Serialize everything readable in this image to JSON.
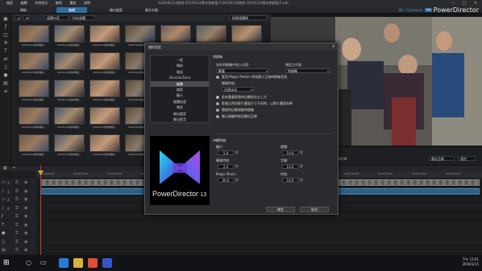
{
  "titlebar": {
    "menu": [
      "檔案",
      "編輯",
      "外掛程式",
      "檢視",
      "播放",
      "說明"
    ],
    "path": "X\\20160114移除-20150124素本物館電子\\20160114移除-20150124素本物館電子.pds",
    "controls": "− □ ×"
  },
  "modebar": {
    "tabs": [
      "擷取",
      "編輯",
      "輸出檔案",
      "製作光碟"
    ],
    "active_tab": 1,
    "account": "登入 CyberLink",
    "badge": "APP",
    "brand": "PowerDirector"
  },
  "library": {
    "dropdown_media": "媒體內容",
    "dropdown_filter": "所有媒體",
    "dropdown_search": "搜尋媒體庫",
    "thumb_caption": "20150124素本物館..."
  },
  "preview": {
    "mode_clip": "片段",
    "mode_movie": "影片",
    "timecode": "00;00;00;00",
    "quality": "最佳品質",
    "zoom": "適合"
  },
  "timeline": {
    "ruler": [
      "00;00;00;00",
      "00;00;10;00",
      "00;00;20;00",
      "00;00;30;00",
      "00;00;40;00",
      "00;00;50;00",
      "00;01;00;00",
      "00;01;10;00",
      "00;01;20;00",
      "00;01;30;00",
      "00;01;40;00",
      "00;01;50;00",
      "00;02;00;00"
    ],
    "tracks": [
      "1.",
      "1.",
      "2.",
      "2.",
      "",
      "",
      "",
      "",
      ""
    ]
  },
  "taskbar": {
    "time": "下午 12:01",
    "date": "2016/1/15"
  },
  "dialog": {
    "title": "偏好設定",
    "close": "×",
    "categories": [
      "一般",
      "擷取",
      "確認",
      "DirectorZone",
      "編輯",
      "檔案",
      "顯示",
      "硬體加速",
      "專案",
      "輸出檔案",
      "匯出影音"
    ],
    "selected_category": 4,
    "section_timeline": "時間軸",
    "label_insert_mode": "如在時間軸中加入內容:",
    "insert_mode_value": "覆蓋",
    "label_default_track": "預設工作區:",
    "default_track_value": "時間軸",
    "opt_magic_motion": "套用 Magic Motion 特效最大正確時間軸音效",
    "label_transition": "轉場特效:",
    "transition_value": "交錯淡化",
    "opt_1": "若有重疊影像時自動貼在左上方",
    "opt_2": "影像比例與影片畫面尺寸不同時，以影片畫面為準",
    "opt_3": "播放時自動捲動時間軸",
    "opt_4": "顯示縮圖時使用最佳品質",
    "section_duration": "持續時間:",
    "label_image": "圖片:",
    "image_val": "5.0",
    "label_title": "標題:",
    "title_val": "10.0",
    "label_transition2": "轉場特效:",
    "transition_val": "2.0",
    "label_subtitle": "字幕:",
    "subtitle_val": "10.0",
    "label_magic": "Magic Music:",
    "magic_val": "30.0",
    "label_effect": "特效:",
    "effect_val": "10.0",
    "unit": "秒",
    "ok": "確定",
    "cancel": "取消",
    "logo_text": "PowerDirector",
    "logo_version": "13"
  }
}
